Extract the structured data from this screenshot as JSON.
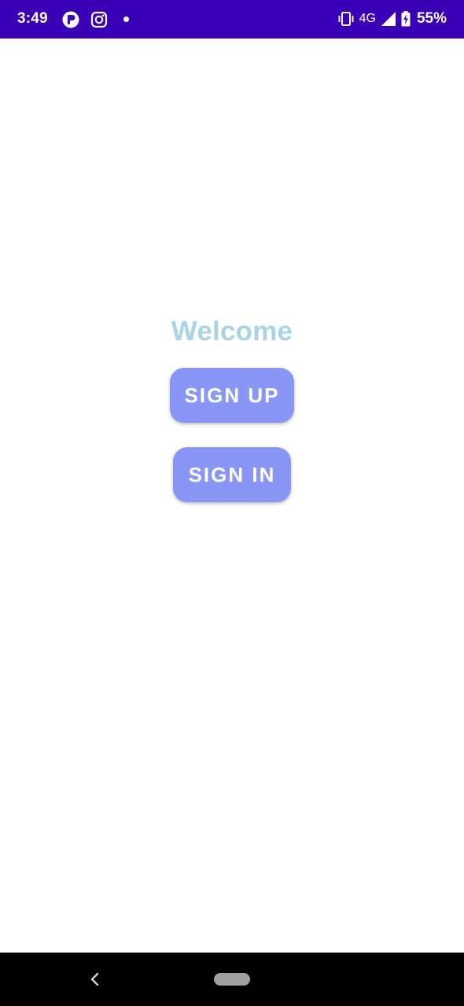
{
  "status_bar": {
    "time": "3:49",
    "network": "4G",
    "battery": "55%",
    "background": "#3a00b5",
    "icons": [
      "app-notification-icon",
      "instagram-icon",
      "notification-dot-icon",
      "vibrate-icon",
      "signal-icon",
      "battery-charging-icon"
    ]
  },
  "main": {
    "welcome_text": "Welcome",
    "welcome_color": "#a9d4e4",
    "signup_label": "SIGN UP",
    "signin_label": "SIGN IN",
    "button_color": "#8a96f6"
  },
  "nav_bar": {
    "icons": [
      "back-icon",
      "home-pill-icon"
    ]
  }
}
